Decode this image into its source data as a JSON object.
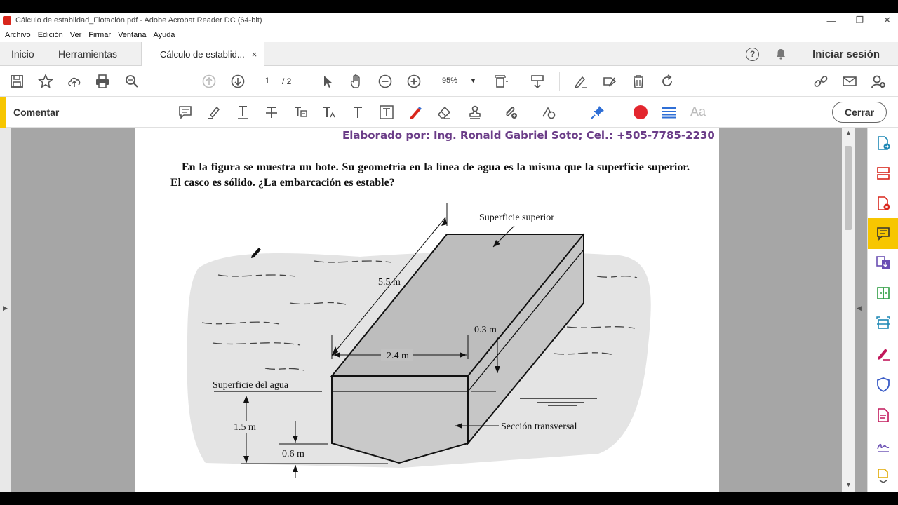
{
  "window": {
    "title": "Cálculo de establidad_Flotación.pdf - Adobe Acrobat Reader DC (64-bit)",
    "minimize": "—",
    "restore": "❐",
    "close": "✕"
  },
  "menu": [
    "Archivo",
    "Edición",
    "Ver",
    "Firmar",
    "Ventana",
    "Ayuda"
  ],
  "tabs": {
    "home": "Inicio",
    "tools": "Herramientas",
    "document": "Cálculo de establid...",
    "close_symbol": "×"
  },
  "header": {
    "help": "?",
    "signin": "Iniciar sesión"
  },
  "toolbar": {
    "page_current": "1",
    "page_total": "/ 2",
    "zoom": "95%"
  },
  "comment_bar": {
    "label": "Comentar",
    "aa": "Aa",
    "close": "Cerrar",
    "accent_color": "#f7c600",
    "record_color": "#e3262e",
    "link_color": "#2f6fd6"
  },
  "document": {
    "author": "Elaborado por: Ing. Ronald Gabriel Soto; Cel.: +505-7785-2230",
    "problem": "En la figura se muestra un bote. Su geometría en la línea de agua es la misma que la superficie superior. El casco es sólido. ¿La embarcación es estable?",
    "figure": {
      "top_surface": "Superficie superior",
      "length": "5.5 m",
      "width": "2.4 m",
      "freeboard": "0.3 m",
      "water_surface": "Superficie del agua",
      "depth": "1.5 m",
      "keel": "0.6 m",
      "cross_section": "Sección transversal"
    }
  }
}
